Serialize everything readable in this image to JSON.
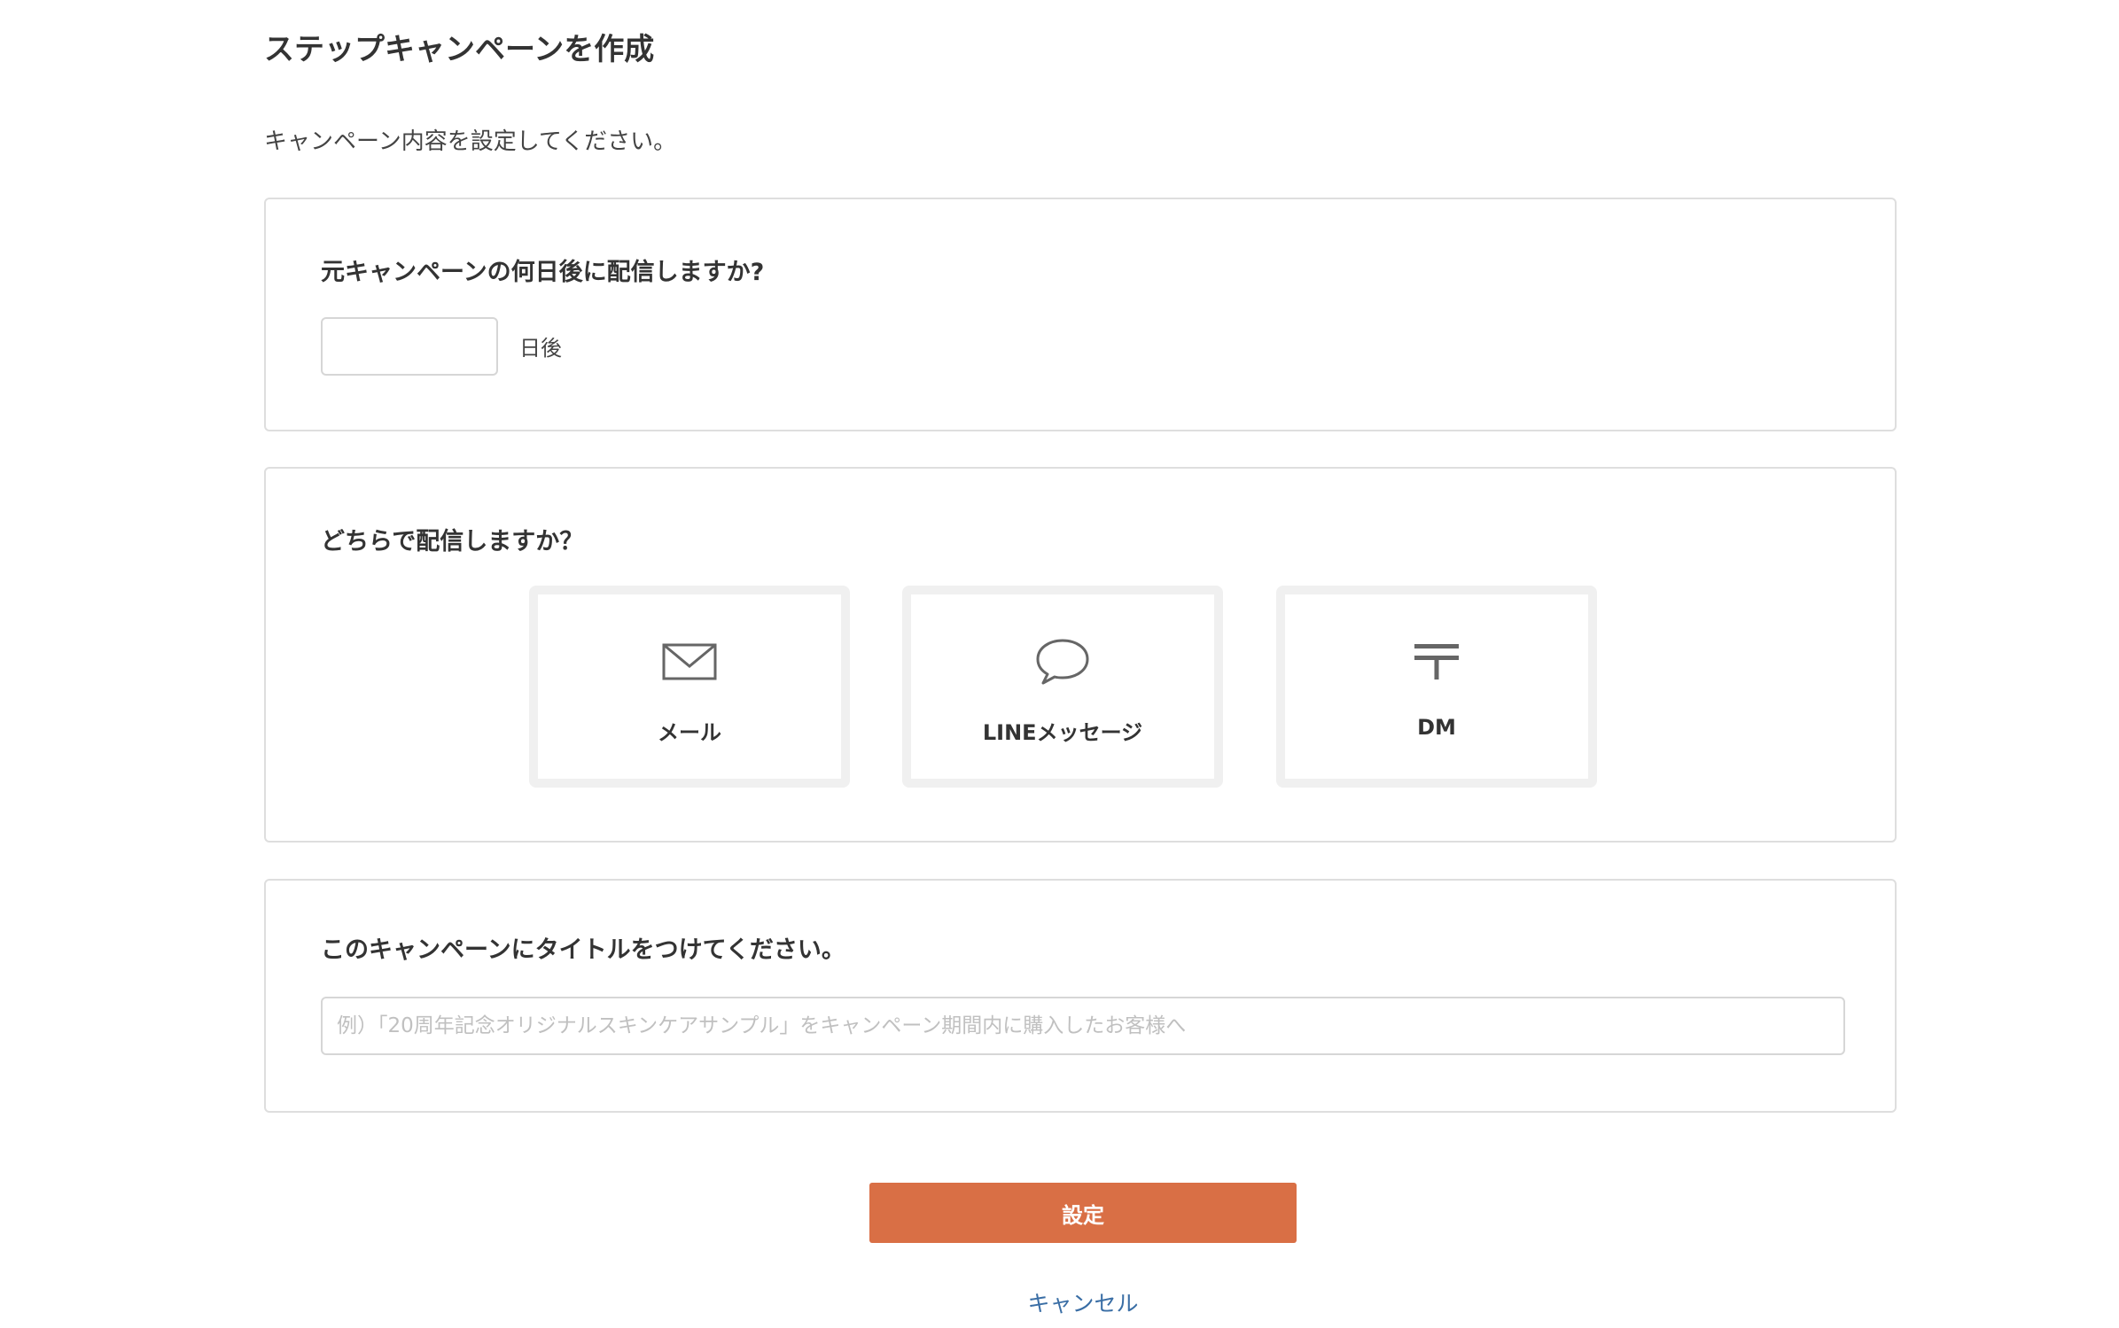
{
  "page": {
    "title": "ステップキャンペーンを作成",
    "subtitle": "キャンペーン内容を設定してください。"
  },
  "days_section": {
    "heading": "元キャンペーンの何日後に配信しますか?",
    "input_value": "",
    "suffix": "日後"
  },
  "channel_section": {
    "heading": "どちらで配信しますか？",
    "options": [
      {
        "label": "メール",
        "icon": "envelope-icon"
      },
      {
        "label": "LINEメッセージ",
        "icon": "speech-bubble-icon"
      },
      {
        "label": "DM",
        "icon": "postal-mark-icon"
      }
    ]
  },
  "title_section": {
    "heading": "このキャンペーンにタイトルをつけてください。",
    "placeholder": "例）「20周年記念オリジナルスキンケアサンプル」をキャンペーン期間内に購入したお客様へ",
    "input_value": ""
  },
  "actions": {
    "submit_label": "設定",
    "cancel_label": "キャンセル"
  },
  "colors": {
    "accent": "#d96f45",
    "link": "#3a6ea5",
    "border": "#dedede"
  }
}
